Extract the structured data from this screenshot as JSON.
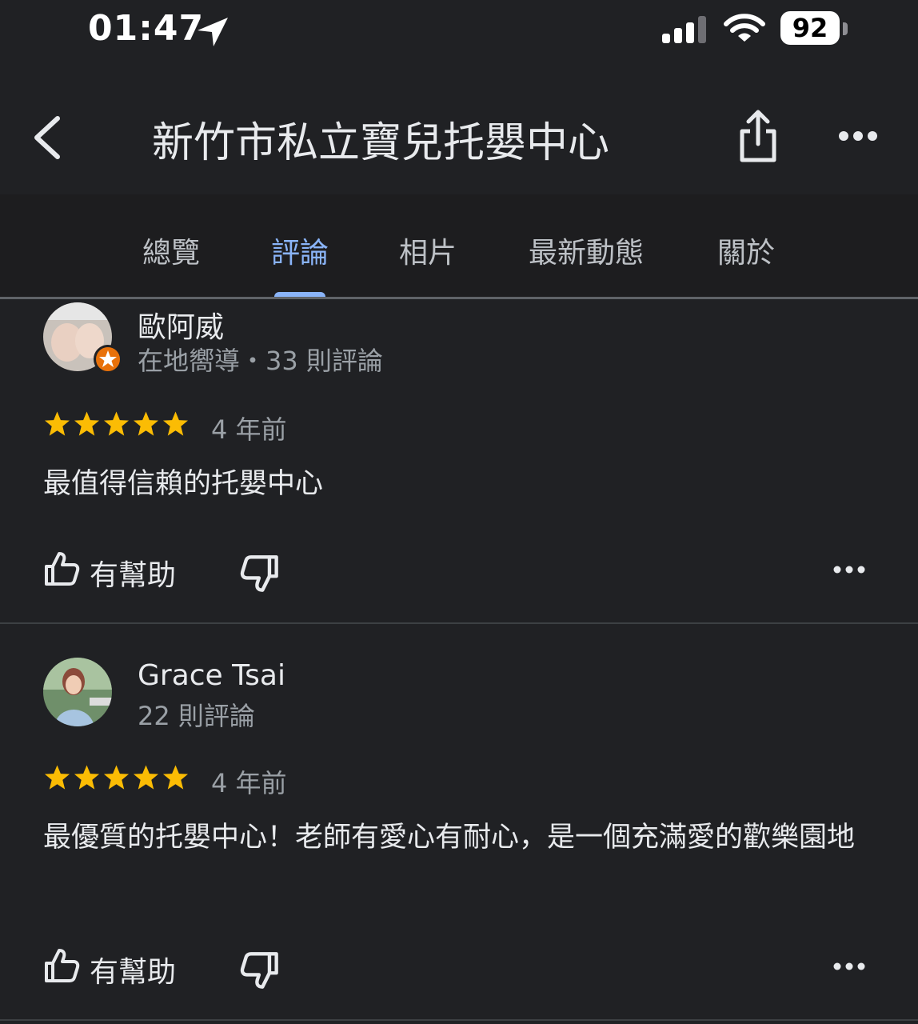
{
  "status_bar": {
    "time": "01:47",
    "battery": "92"
  },
  "header": {
    "title": "新竹市私立寶兒托嬰中心"
  },
  "tabs": [
    {
      "label": "總覽"
    },
    {
      "label": "評論",
      "active": true
    },
    {
      "label": "相片"
    },
    {
      "label": "最新動態"
    },
    {
      "label": "關於"
    }
  ],
  "reviews": [
    {
      "author": "歐阿威",
      "meta": "在地嚮導・33 則評論",
      "rating": 5,
      "date": "4 年前",
      "text": "最值得信賴的托嬰中心",
      "helpful_label": "有幫助"
    },
    {
      "author": "Grace Tsai",
      "meta": "22 則評論",
      "rating": 5,
      "date": "4 年前",
      "text": "最優質的托嬰中心！老師有愛心有耐心，是一個充滿愛的歡樂園地",
      "helpful_label": "有幫助"
    }
  ],
  "colors": {
    "accent": "#8ab4f8",
    "star": "#fbbc04",
    "badge": "#e8710a",
    "background": "#202124"
  }
}
